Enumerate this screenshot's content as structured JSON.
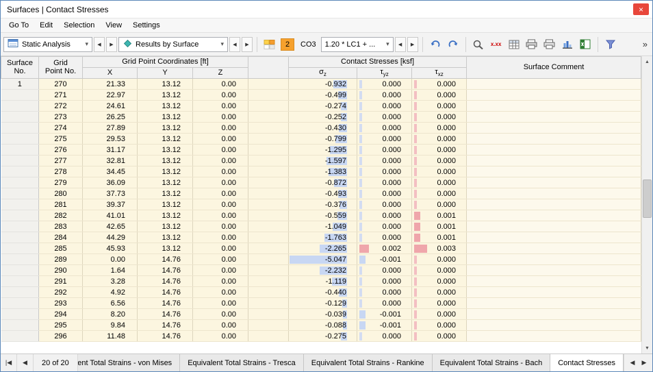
{
  "window": {
    "title": "Surfaces | Contact Stresses"
  },
  "icons": {
    "close": "×",
    "dropdown": "▾",
    "prev": "◀",
    "next": "▶",
    "first_tab": "|◀",
    "prev_tab": "◀",
    "next_tab": "▶",
    "up": "▲",
    "down": "▼",
    "overflow": "»",
    "values_label": "x.xx"
  },
  "menu": {
    "items": [
      "Go To",
      "Edit",
      "Selection",
      "View",
      "Settings"
    ]
  },
  "toolbar": {
    "analysis_value": "Static Analysis",
    "results_value": "Results by Surface",
    "case_badge": "2",
    "case_label": "CO3",
    "combination_value": "1.20 * LC1 + ..."
  },
  "colors": {
    "bar_negative": "#c8d7f3",
    "bar_positive": "#efa6ab",
    "bar_zero_blue": "#d3dcf1",
    "bar_zero_pink": "#f3bfc2",
    "accent_orange": "#f6a12d",
    "close_red": "#e8473b"
  },
  "table": {
    "headers": {
      "surface_line1": "Surface",
      "surface_line2": "No.",
      "grid_line1": "Grid",
      "grid_line2": "Point No.",
      "coords_group": "Grid Point Coordinates [ft]",
      "x": "X",
      "y": "Y",
      "z": "Z",
      "stresses_group": "Contact Stresses [ksf]",
      "sigma": {
        "base": "σ",
        "sub": "z"
      },
      "tau_yz": {
        "base": "τ",
        "sub": "yz"
      },
      "tau_xz": {
        "base": "τ",
        "sub": "xz"
      },
      "comment": "Surface Comment"
    },
    "columns": [
      "surface_no",
      "point_no",
      "x",
      "y",
      "z",
      "sigma_z",
      "tau_yz",
      "tau_xz"
    ],
    "rows": [
      [
        "1",
        "270",
        "21.33",
        "13.12",
        "0.00",
        "-0.932",
        "0.000",
        "0.000"
      ],
      [
        "",
        "271",
        "22.97",
        "13.12",
        "0.00",
        "-0.499",
        "0.000",
        "0.000"
      ],
      [
        "",
        "272",
        "24.61",
        "13.12",
        "0.00",
        "-0.274",
        "0.000",
        "0.000"
      ],
      [
        "",
        "273",
        "26.25",
        "13.12",
        "0.00",
        "-0.252",
        "0.000",
        "0.000"
      ],
      [
        "",
        "274",
        "27.89",
        "13.12",
        "0.00",
        "-0.430",
        "0.000",
        "0.000"
      ],
      [
        "",
        "275",
        "29.53",
        "13.12",
        "0.00",
        "-0.799",
        "0.000",
        "0.000"
      ],
      [
        "",
        "276",
        "31.17",
        "13.12",
        "0.00",
        "-1.295",
        "0.000",
        "0.000"
      ],
      [
        "",
        "277",
        "32.81",
        "13.12",
        "0.00",
        "-1.597",
        "0.000",
        "0.000"
      ],
      [
        "",
        "278",
        "34.45",
        "13.12",
        "0.00",
        "-1.383",
        "0.000",
        "0.000"
      ],
      [
        "",
        "279",
        "36.09",
        "13.12",
        "0.00",
        "-0.872",
        "0.000",
        "0.000"
      ],
      [
        "",
        "280",
        "37.73",
        "13.12",
        "0.00",
        "-0.493",
        "0.000",
        "0.000"
      ],
      [
        "",
        "281",
        "39.37",
        "13.12",
        "0.00",
        "-0.376",
        "0.000",
        "0.000"
      ],
      [
        "",
        "282",
        "41.01",
        "13.12",
        "0.00",
        "-0.559",
        "0.000",
        "0.001"
      ],
      [
        "",
        "283",
        "42.65",
        "13.12",
        "0.00",
        "-1.049",
        "0.000",
        "0.001"
      ],
      [
        "",
        "284",
        "44.29",
        "13.12",
        "0.00",
        "-1.763",
        "0.000",
        "0.001"
      ],
      [
        "",
        "285",
        "45.93",
        "13.12",
        "0.00",
        "-2.265",
        "0.002",
        "0.003"
      ],
      [
        "",
        "289",
        "0.00",
        "14.76",
        "0.00",
        "-5.047",
        "-0.001",
        "0.000"
      ],
      [
        "",
        "290",
        "1.64",
        "14.76",
        "0.00",
        "-2.232",
        "0.000",
        "0.000"
      ],
      [
        "",
        "291",
        "3.28",
        "14.76",
        "0.00",
        "-1.119",
        "0.000",
        "0.000"
      ],
      [
        "",
        "292",
        "4.92",
        "14.76",
        "0.00",
        "-0.440",
        "0.000",
        "0.000"
      ],
      [
        "",
        "293",
        "6.56",
        "14.76",
        "0.00",
        "-0.129",
        "0.000",
        "0.000"
      ],
      [
        "",
        "294",
        "8.20",
        "14.76",
        "0.00",
        "-0.039",
        "-0.001",
        "0.000"
      ],
      [
        "",
        "295",
        "9.84",
        "14.76",
        "0.00",
        "-0.088",
        "-0.001",
        "0.000"
      ],
      [
        "",
        "296",
        "11.48",
        "14.76",
        "0.00",
        "-0.275",
        "0.000",
        "0.000"
      ]
    ]
  },
  "bottombar": {
    "count": "20 of 20",
    "tabs": [
      {
        "label": "Equivalent Total Strains - von Mises",
        "active": false
      },
      {
        "label": "Equivalent Total Strains - Tresca",
        "active": false
      },
      {
        "label": "Equivalent Total Strains - Rankine",
        "active": false
      },
      {
        "label": "Equivalent Total Strains - Bach",
        "active": false
      },
      {
        "label": "Contact Stresses",
        "active": true
      }
    ]
  }
}
